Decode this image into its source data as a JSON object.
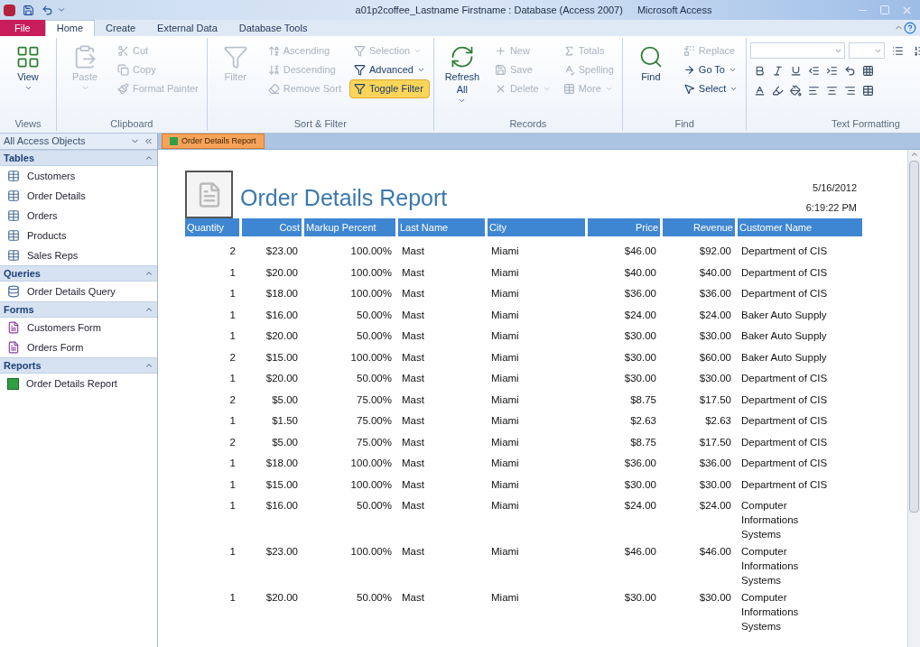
{
  "window": {
    "title": "a01p2coffee_Lastname Firstname : Database (Access 2007)",
    "app": "Microsoft Access"
  },
  "ribbon_tabs": [
    {
      "label": "File",
      "selected": false,
      "kind": "file"
    },
    {
      "label": "Home",
      "selected": true,
      "kind": "tab"
    },
    {
      "label": "Create",
      "selected": false,
      "kind": "tab"
    },
    {
      "label": "External Data",
      "selected": false,
      "kind": "tab"
    },
    {
      "label": "Database Tools",
      "selected": false,
      "kind": "tab"
    }
  ],
  "ribbon_groups": [
    {
      "label": "Views",
      "items": [
        {
          "label": "View",
          "kind": "large",
          "disabled": false,
          "highlighted": false,
          "dropdown": true
        }
      ]
    },
    {
      "label": "Clipboard",
      "items": [
        {
          "label": "Paste",
          "kind": "large",
          "disabled": true,
          "highlighted": false,
          "dropdown": true
        },
        {
          "label": "Cut",
          "kind": "small",
          "disabled": true,
          "highlighted": false,
          "dropdown": false
        },
        {
          "label": "Copy",
          "kind": "small",
          "disabled": true,
          "highlighted": false,
          "dropdown": false
        },
        {
          "label": "Format Painter",
          "kind": "small",
          "disabled": true,
          "highlighted": false,
          "dropdown": false
        }
      ]
    },
    {
      "label": "Sort & Filter",
      "items": [
        {
          "label": "Filter",
          "kind": "large",
          "disabled": true,
          "highlighted": false,
          "dropdown": false
        },
        {
          "label": "Ascending",
          "kind": "small",
          "disabled": true,
          "highlighted": false,
          "dropdown": false
        },
        {
          "label": "Descending",
          "kind": "small",
          "disabled": true,
          "highlighted": false,
          "dropdown": false
        },
        {
          "label": "Remove Sort",
          "kind": "small",
          "disabled": true,
          "highlighted": false,
          "dropdown": false
        },
        {
          "label": "Selection",
          "kind": "small",
          "disabled": true,
          "highlighted": false,
          "dropdown": true
        },
        {
          "label": "Advanced",
          "kind": "small",
          "disabled": false,
          "highlighted": false,
          "dropdown": true
        },
        {
          "label": "Toggle Filter",
          "kind": "small",
          "disabled": false,
          "highlighted": true,
          "dropdown": false
        }
      ]
    },
    {
      "label": "Records",
      "items": [
        {
          "label": "Refresh All",
          "kind": "large",
          "disabled": false,
          "highlighted": false,
          "dropdown": true
        },
        {
          "label": "New",
          "kind": "small",
          "disabled": true,
          "highlighted": false,
          "dropdown": false
        },
        {
          "label": "Save",
          "kind": "small",
          "disabled": true,
          "highlighted": false,
          "dropdown": false
        },
        {
          "label": "Delete",
          "kind": "small",
          "disabled": true,
          "highlighted": false,
          "dropdown": true
        },
        {
          "label": "Totals",
          "kind": "small",
          "disabled": true,
          "highlighted": false,
          "dropdown": false
        },
        {
          "label": "Spelling",
          "kind": "small",
          "disabled": true,
          "highlighted": false,
          "dropdown": false
        },
        {
          "label": "More",
          "kind": "small",
          "disabled": true,
          "highlighted": false,
          "dropdown": true
        }
      ]
    },
    {
      "label": "Find",
      "items": [
        {
          "label": "Find",
          "kind": "large",
          "disabled": false,
          "highlighted": false,
          "dropdown": false
        },
        {
          "label": "Replace",
          "kind": "small",
          "disabled": true,
          "highlighted": false,
          "dropdown": false
        },
        {
          "label": "Go To",
          "kind": "small",
          "disabled": false,
          "highlighted": false,
          "dropdown": true
        },
        {
          "label": "Select",
          "kind": "small",
          "disabled": false,
          "highlighted": false,
          "dropdown": true
        }
      ]
    },
    {
      "label": "Text Formatting"
    }
  ],
  "nav_pane": {
    "title": "All Access Objects",
    "groups": [
      {
        "label": "Tables",
        "expanded": true,
        "items": [
          {
            "label": "Customers",
            "kind": "table"
          },
          {
            "label": "Order Details",
            "kind": "table"
          },
          {
            "label": "Orders",
            "kind": "table"
          },
          {
            "label": "Products",
            "kind": "table"
          },
          {
            "label": "Sales Reps",
            "kind": "table"
          }
        ]
      },
      {
        "label": "Queries",
        "expanded": true,
        "items": [
          {
            "label": "Order Details Query",
            "kind": "query"
          }
        ]
      },
      {
        "label": "Forms",
        "expanded": true,
        "items": [
          {
            "label": "Customers Form",
            "kind": "form"
          },
          {
            "label": "Orders Form",
            "kind": "form"
          }
        ]
      },
      {
        "label": "Reports",
        "expanded": true,
        "items": [
          {
            "label": "Order Details Report",
            "kind": "report"
          }
        ]
      }
    ]
  },
  "document_tab": {
    "label": "Order Details Report"
  },
  "report": {
    "title": "Order Details Report",
    "date": "5/16/2012",
    "time": "6:19:22 PM",
    "columns": [
      "Quantity",
      "Cost",
      "Markup Percent",
      "Last Name",
      "City",
      "Price",
      "Revenue",
      "Customer Name"
    ],
    "rows": [
      [
        "2",
        "$23.00",
        "100.00%",
        "Mast",
        "Miami",
        "$46.00",
        "$92.00",
        "Department of CIS"
      ],
      [
        "1",
        "$20.00",
        "100.00%",
        "Mast",
        "Miami",
        "$40.00",
        "$40.00",
        "Department of CIS"
      ],
      [
        "1",
        "$18.00",
        "100.00%",
        "Mast",
        "Miami",
        "$36.00",
        "$36.00",
        "Department of CIS"
      ],
      [
        "1",
        "$16.00",
        "50.00%",
        "Mast",
        "Miami",
        "$24.00",
        "$24.00",
        "Baker Auto Supply"
      ],
      [
        "1",
        "$20.00",
        "50.00%",
        "Mast",
        "Miami",
        "$30.00",
        "$30.00",
        "Baker Auto Supply"
      ],
      [
        "2",
        "$15.00",
        "100.00%",
        "Mast",
        "Miami",
        "$30.00",
        "$60.00",
        "Baker Auto Supply"
      ],
      [
        "1",
        "$20.00",
        "50.00%",
        "Mast",
        "Miami",
        "$30.00",
        "$30.00",
        "Department of CIS"
      ],
      [
        "2",
        "$5.00",
        "75.00%",
        "Mast",
        "Miami",
        "$8.75",
        "$17.50",
        "Department of CIS"
      ],
      [
        "1",
        "$1.50",
        "75.00%",
        "Mast",
        "Miami",
        "$2.63",
        "$2.63",
        "Department of CIS"
      ],
      [
        "2",
        "$5.00",
        "75.00%",
        "Mast",
        "Miami",
        "$8.75",
        "$17.50",
        "Department of CIS"
      ],
      [
        "1",
        "$18.00",
        "100.00%",
        "Mast",
        "Miami",
        "$36.00",
        "$36.00",
        "Department of CIS"
      ],
      [
        "1",
        "$15.00",
        "100.00%",
        "Mast",
        "Miami",
        "$30.00",
        "$30.00",
        "Department of CIS"
      ],
      [
        "1",
        "$16.00",
        "50.00%",
        "Mast",
        "Miami",
        "$24.00",
        "$24.00",
        "Computer Informations Systems"
      ],
      [
        "1",
        "$23.00",
        "100.00%",
        "Mast",
        "Miami",
        "$46.00",
        "$46.00",
        "Computer Informations Systems"
      ],
      [
        "1",
        "$20.00",
        "50.00%",
        "Mast",
        "Miami",
        "$30.00",
        "$30.00",
        "Computer Informations Systems"
      ]
    ]
  }
}
